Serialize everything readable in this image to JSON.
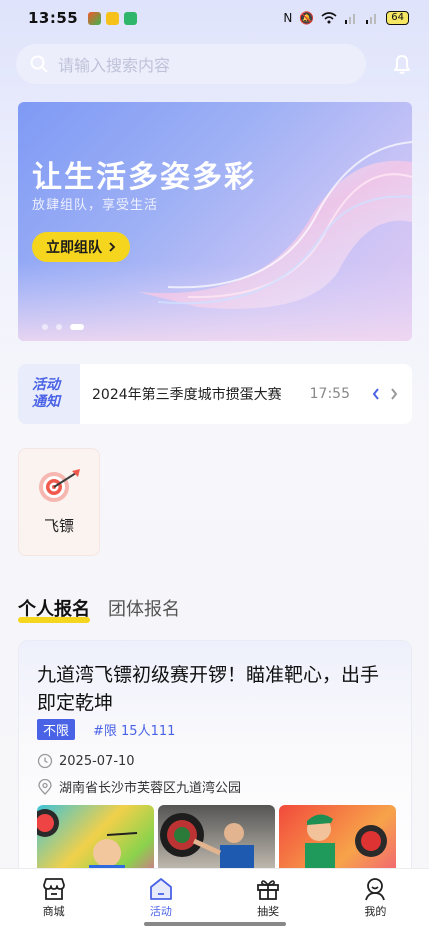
{
  "status_bar": {
    "time": "13:55",
    "battery": "64"
  },
  "search": {
    "placeholder": "请输入搜索内容"
  },
  "banner": {
    "title": "让生活多姿多彩",
    "subtitle": "放肆组队，享受生活",
    "button_label": "立即组队"
  },
  "notice": {
    "tag_line1": "活动",
    "tag_line2": "通知",
    "text": "2024年第三季度城市掼蛋大赛",
    "time": "17:55"
  },
  "category": {
    "label": "飞镖"
  },
  "tabs": [
    {
      "label": "个人报名"
    },
    {
      "label": "团体报名"
    }
  ],
  "event_card": {
    "title": "九道湾飞镖初级赛开锣！瞄准靶心，出手即定乾坤",
    "badge": "不限",
    "limit": "#限 15人111",
    "date": "2025-07-10",
    "address": "湖南省长沙市芙蓉区九道湾公园"
  },
  "bottom_nav": [
    {
      "label": "商城"
    },
    {
      "label": "活动"
    },
    {
      "label": "抽奖"
    },
    {
      "label": "我的"
    }
  ],
  "colors": {
    "accent": "#4a63e6",
    "yellow": "#f6d51f"
  }
}
